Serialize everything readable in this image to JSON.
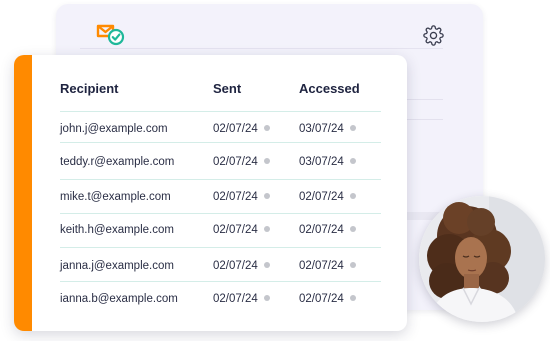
{
  "table": {
    "headers": {
      "recipient": "Recipient",
      "sent": "Sent",
      "accessed": "Accessed"
    },
    "rows": [
      {
        "email": "john.j@example.com",
        "sent": "02/07/24",
        "accessed": "03/07/24"
      },
      {
        "email": "teddy.r@example.com",
        "sent": "02/07/24",
        "accessed": "03/07/24"
      },
      {
        "email": "mike.t@example.com",
        "sent": "02/07/24",
        "accessed": "02/07/24"
      },
      {
        "email": "keith.h@example.com",
        "sent": "02/07/24",
        "accessed": "02/07/24"
      },
      {
        "email": "janna.j@example.com",
        "sent": "02/07/24",
        "accessed": "02/07/24"
      },
      {
        "email": "ianna.b@example.com",
        "sent": "02/07/24",
        "accessed": "02/07/24"
      }
    ]
  },
  "icons": {
    "logo": "envelope-check-icon",
    "settings": "gear-icon"
  },
  "colors": {
    "accent": "#ff8a00",
    "check": "#1fb89a",
    "status_dot": "#c4c6cc"
  }
}
